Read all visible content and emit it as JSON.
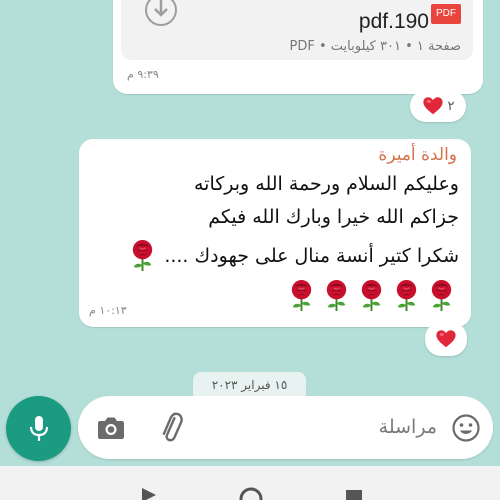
{
  "document_message": {
    "file_name": "pdf.190",
    "badge": "PDF",
    "meta": "صفحة ١ • ٣٠١ كيلوبايت • PDF",
    "time": "٩:٣٩ م",
    "reaction_count": "٢"
  },
  "text_message": {
    "sender": "والدة أميرة",
    "lines": [
      "وعليكم السلام ورحمة الله وبركاته",
      "جزاكم الله خيرا وبارك الله فيكم",
      "شكرا كتير أنسة منال على جهودك ...."
    ],
    "time": "١٠:١٣ م"
  },
  "date_chip": "١٥ فبراير ٢٠٢٣",
  "composer": {
    "placeholder": "مراسلة"
  },
  "icons": {
    "mic": "mic-icon",
    "camera": "camera-icon",
    "attach": "paperclip-icon",
    "emoji": "emoji-icon",
    "reaction": "red-heart-emoji",
    "rose": "rose-emoji"
  },
  "colors": {
    "wallpaper": "#b4dfd8",
    "accent": "#1a9b82",
    "sender_name": "#d4734a",
    "pdf_badge": "#e9453d"
  }
}
